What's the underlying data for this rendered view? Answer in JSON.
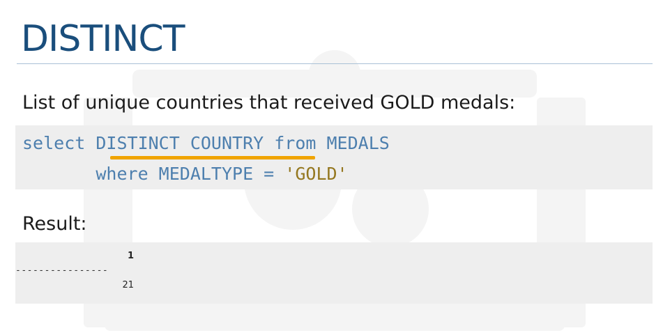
{
  "slide": {
    "title": "DISTINCT",
    "subtitle": "List of unique countries that received GOLD medals:",
    "code": {
      "line1_keyword": "select ",
      "line1_highlight": "DISTINCT COUNTRY",
      "line1_rest": " from MEDALS",
      "line2_indent": "       ",
      "line2_main": "where MEDALTYPE = ",
      "line2_string": "'GOLD'"
    },
    "result_label": "Result:",
    "result": {
      "column_header": "1",
      "separator": "----------------",
      "value": "21"
    }
  },
  "colors": {
    "title": "#1a4e7c",
    "code_text": "#4d7fae",
    "code_string": "#94771f",
    "highlight_underline": "#f0a400",
    "box_background": "#eeeeee"
  },
  "icons": [
    "watermark-logo"
  ]
}
